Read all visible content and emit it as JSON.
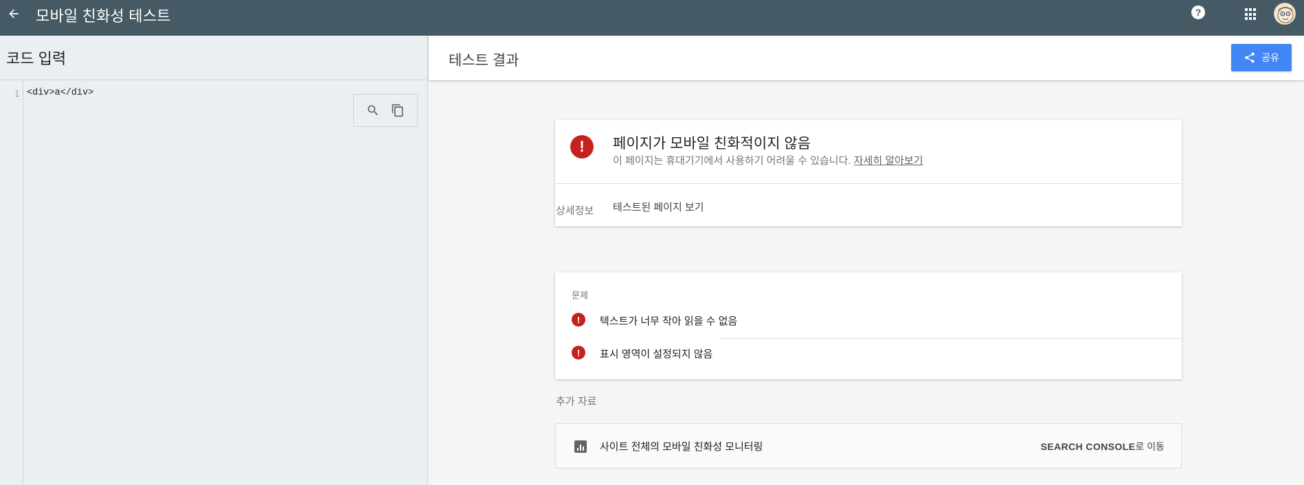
{
  "app": {
    "title": "모바일 친화성 테스트",
    "help_label": "?"
  },
  "code_panel": {
    "heading": "코드 입력",
    "line_number": "1",
    "code_line": "<div>a</div>",
    "tools": [
      "search-icon",
      "copy-icon"
    ]
  },
  "results": {
    "heading": "테스트 결과",
    "share_label": "공유",
    "status": {
      "headline": "페이지가 모바일 친화적이지 않음",
      "description": "이 페이지는 휴대기기에서 사용하기 어려울 수 있습니다.",
      "learn_more": "자세히 알아보기",
      "view_tested_page": "테스트된 페이지 보기"
    },
    "details_heading": "상세정보",
    "issues_label": "문제",
    "issues": [
      "텍스트가 너무 작아 읽을 수 없음",
      "표시 영역이 설정되지 않음"
    ],
    "resources_heading": "추가 자료",
    "resource": {
      "label": "사이트 전체의 모바일 친화성 모니터링",
      "link_bold": "SEARCH CONSOLE",
      "link_suffix": "로 이동"
    }
  },
  "colors": {
    "topbar": "#455a64",
    "accent": "#4285f4",
    "error": "#c5221f"
  }
}
